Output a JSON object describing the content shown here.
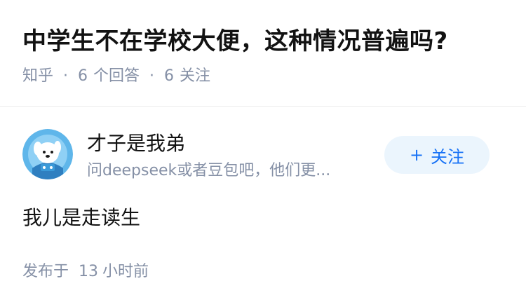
{
  "question": {
    "title": "中学生不在学校大便，这种情况普遍吗?",
    "meta": {
      "site": "知乎",
      "answer_count": "6",
      "answer_label": "个回答",
      "follower_count": "6",
      "follower_label": "关注"
    }
  },
  "answer": {
    "author": {
      "name": "才子是我弟",
      "headline": "问deepseek或者豆包吧，他们更..."
    },
    "follow_button": {
      "icon": "plus-icon",
      "plus": "+",
      "label": "关注"
    },
    "content": "我儿是走读生",
    "published": {
      "prefix": "发布于",
      "number": "13",
      "suffix": "小时前"
    }
  },
  "colors": {
    "title": "#121212",
    "meta": "#8590a6",
    "follow_bg": "#ebf5fd",
    "follow_text": "#1772f6",
    "avatar_bg": "#5fb6ea"
  }
}
